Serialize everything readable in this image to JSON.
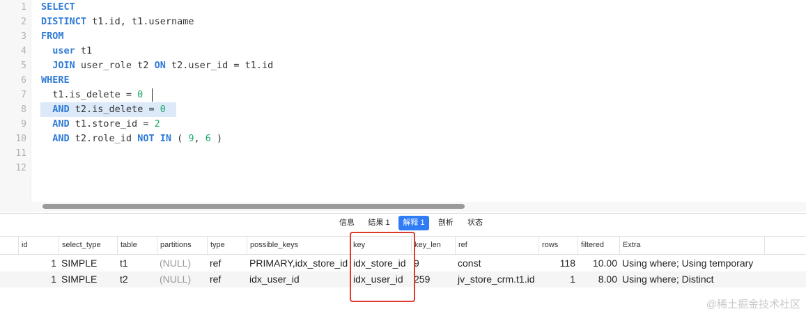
{
  "editor": {
    "line_numbers": [
      "1",
      "2",
      "3",
      "4",
      "5",
      "6",
      "7",
      "8",
      "9",
      "10",
      "11",
      "12"
    ],
    "lines": [
      [
        {
          "t": "SELECT",
          "c": "kw"
        }
      ],
      [
        {
          "t": "DISTINCT",
          "c": "kw"
        },
        {
          "t": " t1.id, t1.username",
          "c": ""
        }
      ],
      [
        {
          "t": "FROM",
          "c": "kw"
        }
      ],
      [
        {
          "t": "  ",
          "c": ""
        },
        {
          "t": "user",
          "c": "kw"
        },
        {
          "t": " t1",
          "c": ""
        }
      ],
      [
        {
          "t": "  ",
          "c": ""
        },
        {
          "t": "JOIN",
          "c": "kw"
        },
        {
          "t": " user_role t2 ",
          "c": ""
        },
        {
          "t": "ON",
          "c": "kw"
        },
        {
          "t": " t2.user_id = t1.id",
          "c": ""
        }
      ],
      [
        {
          "t": "WHERE",
          "c": "kw"
        }
      ],
      [
        {
          "t": "  t1.is_delete = ",
          "c": ""
        },
        {
          "t": "0",
          "c": "num"
        }
      ],
      [
        {
          "t": "  ",
          "c": ""
        },
        {
          "t": "AND",
          "c": "kw"
        },
        {
          "t": " t2.is_delete = ",
          "c": ""
        },
        {
          "t": "0",
          "c": "num"
        }
      ],
      [
        {
          "t": "  ",
          "c": ""
        },
        {
          "t": "AND",
          "c": "kw"
        },
        {
          "t": " t1.store_id = ",
          "c": ""
        },
        {
          "t": "2",
          "c": "num"
        }
      ],
      [
        {
          "t": "  ",
          "c": ""
        },
        {
          "t": "AND",
          "c": "kw"
        },
        {
          "t": " t2.role_id ",
          "c": ""
        },
        {
          "t": "NOT IN",
          "c": "kw"
        },
        {
          "t": " ( ",
          "c": ""
        },
        {
          "t": "9",
          "c": "num"
        },
        {
          "t": ", ",
          "c": ""
        },
        {
          "t": "6",
          "c": "num"
        },
        {
          "t": " )",
          "c": ""
        }
      ],
      [],
      []
    ]
  },
  "tabs": [
    {
      "label": "信息",
      "active": false
    },
    {
      "label": "结果 1",
      "active": false
    },
    {
      "label": "解释 1",
      "active": true
    },
    {
      "label": "剖析",
      "active": false
    },
    {
      "label": "状态",
      "active": false
    }
  ],
  "grid": {
    "columns": [
      "id",
      "select_type",
      "table",
      "partitions",
      "type",
      "possible_keys",
      "key",
      "key_len",
      "ref",
      "rows",
      "filtered",
      "Extra"
    ],
    "rows": [
      [
        "1",
        "SIMPLE",
        "t1",
        "(NULL)",
        "ref",
        "PRIMARY,idx_store_id",
        "idx_store_id",
        "9",
        "const",
        "118",
        "10.00",
        "Using where; Using temporary"
      ],
      [
        "1",
        "SIMPLE",
        "t2",
        "(NULL)",
        "ref",
        "idx_user_id",
        "idx_user_id",
        "259",
        "jv_store_crm.t1.id",
        "1",
        "8.00",
        "Using where; Distinct"
      ]
    ]
  },
  "colors": {
    "keyword": "#2f7bd6",
    "number": "#1aa86a",
    "active_tab": "#2f7cf6",
    "annotation": "#e03a2c"
  },
  "watermark": "@稀土掘金技术社区"
}
